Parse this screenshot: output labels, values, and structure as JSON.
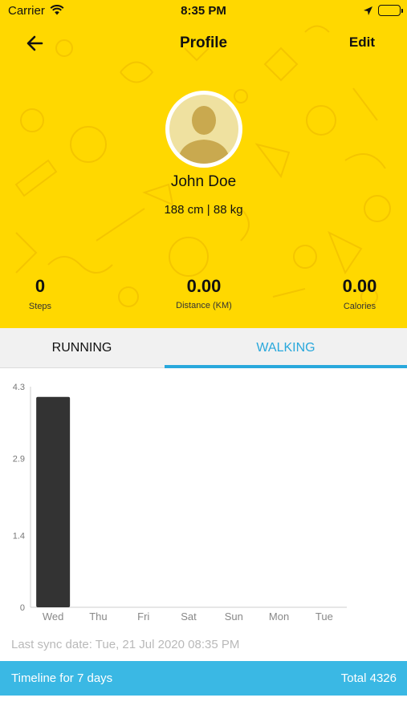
{
  "status_bar": {
    "carrier": "Carrier",
    "time": "8:35 PM",
    "icons": [
      "wifi-icon",
      "location-icon",
      "battery-icon"
    ]
  },
  "nav": {
    "title": "Profile",
    "edit_label": "Edit",
    "back_icon": "arrow-left-icon"
  },
  "profile": {
    "name": "John Doe",
    "metrics": "188 cm | 88 kg",
    "avatar_icon": "person-silhouette-icon"
  },
  "stats": {
    "steps_value": "0",
    "steps_label": "Steps",
    "distance_value": "0.00",
    "distance_label": "Distance (KM)",
    "calories_value": "0.00",
    "calories_label": "Calories"
  },
  "tabs": {
    "running_label": "RUNNING",
    "walking_label": "WALKING",
    "active": "walking"
  },
  "chart_data": {
    "type": "bar",
    "categories": [
      "Wed",
      "Thu",
      "Fri",
      "Sat",
      "Sun",
      "Mon",
      "Tue"
    ],
    "values": [
      4.1,
      0,
      0,
      0,
      0,
      0,
      0
    ],
    "y_ticks": [
      "0",
      "1.4",
      "2.9",
      "4.3"
    ],
    "y_tick_values": [
      0,
      1.4,
      2.9,
      4.3
    ],
    "ylim": [
      0,
      4.3
    ],
    "bar_color": "#333333",
    "grid": false
  },
  "sync": {
    "text": "Last sync date: Tue, 21 Jul 2020 08:35 PM"
  },
  "footer": {
    "timeline_label": "Timeline for 7 days",
    "total_label": "Total 4326"
  },
  "colors": {
    "header_bg": "#ffd800",
    "accent": "#29a8dc",
    "footer_bg": "#3ab8e4"
  }
}
